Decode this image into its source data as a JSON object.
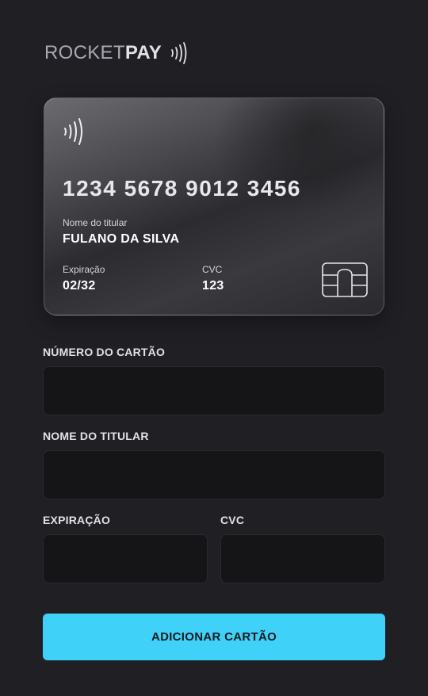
{
  "brand": {
    "light": "ROCKET",
    "bold": "PAY",
    "waves_icon": "contactless-icon"
  },
  "card": {
    "number": "1234 5678 9012 3456",
    "holder_label": "Nome do titular",
    "holder_value": "FULANO DA SILVA",
    "expiry_label": "Expiração",
    "expiry_value": "02/32",
    "cvc_label": "CVC",
    "cvc_value": "123",
    "chip_icon": "chip-icon"
  },
  "form": {
    "number_label": "NÚMERO DO CARTÃO",
    "number_value": "",
    "holder_label": "NOME DO TITULAR",
    "holder_value": "",
    "expiry_label": "EXPIRAÇÃO",
    "expiry_value": "",
    "cvc_label": "CVC",
    "cvc_value": "",
    "submit_label": "ADICIONAR CARTÃO"
  },
  "colors": {
    "background": "#202024",
    "input_bg": "#151518",
    "accent": "#3fd1f8"
  }
}
